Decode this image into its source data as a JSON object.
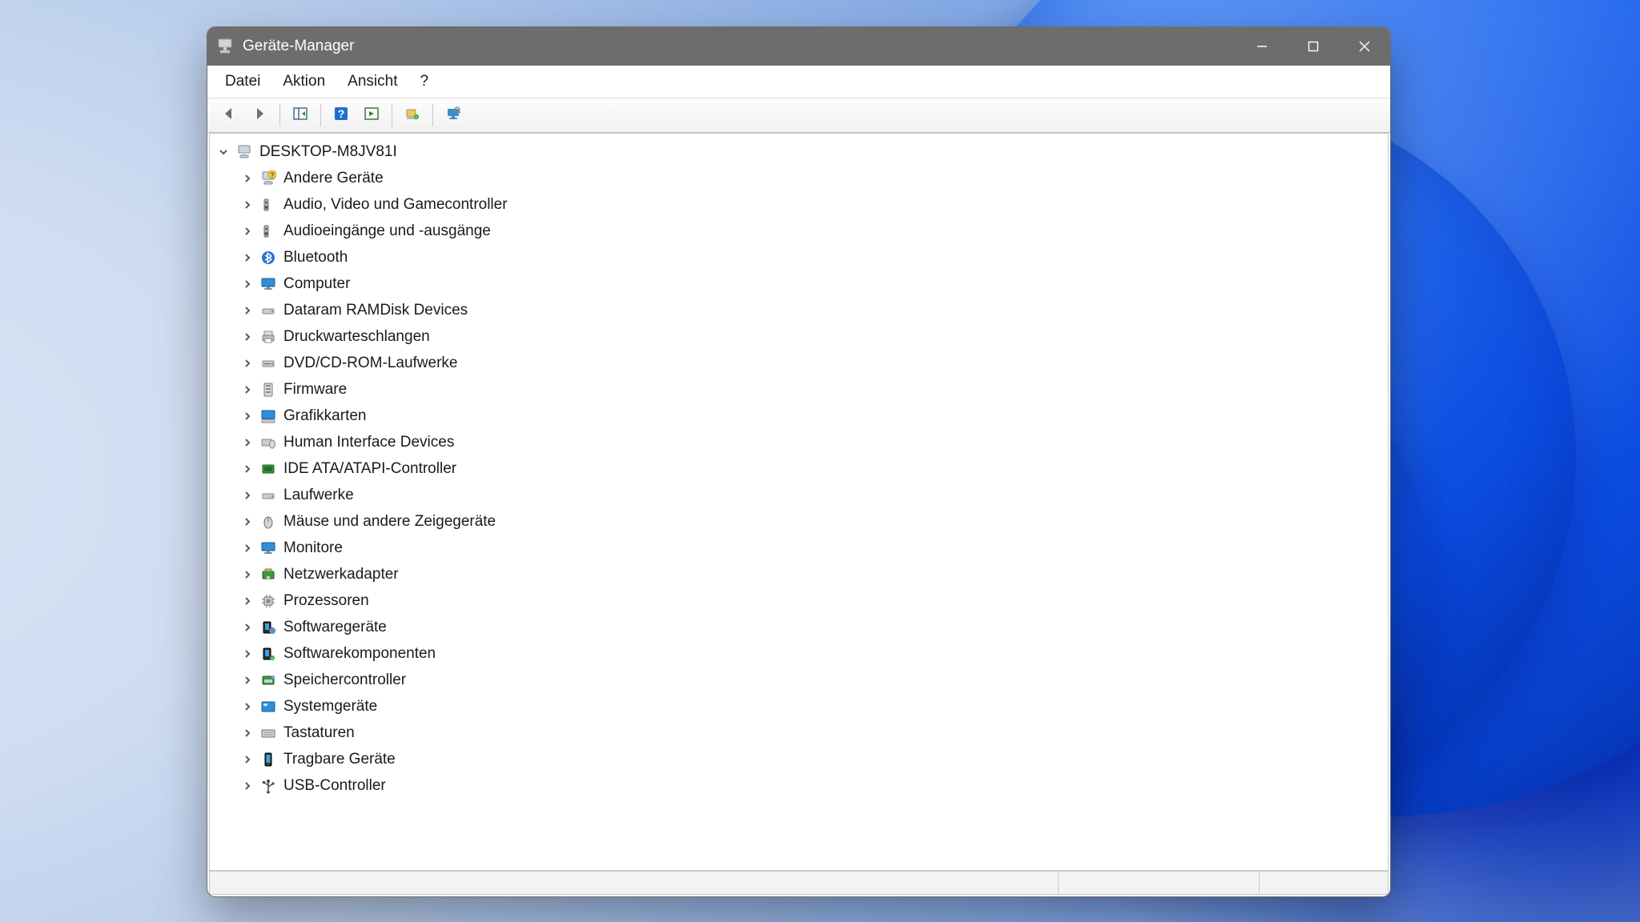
{
  "window": {
    "title": "Geräte-Manager"
  },
  "menubar": {
    "items": [
      "Datei",
      "Aktion",
      "Ansicht",
      "?"
    ]
  },
  "toolbar": {
    "buttons": [
      {
        "name": "nav-back-icon"
      },
      {
        "name": "nav-forward-icon"
      },
      {
        "sep": true
      },
      {
        "name": "show-hide-tree-icon"
      },
      {
        "sep": true
      },
      {
        "name": "help-icon"
      },
      {
        "name": "properties-icon"
      },
      {
        "sep": true
      },
      {
        "name": "update-driver-icon"
      },
      {
        "sep": true
      },
      {
        "name": "scan-hardware-icon"
      }
    ]
  },
  "tree": {
    "root": {
      "label": "DESKTOP-M8JV81I",
      "icon": "computer-root-icon",
      "expanded": true
    },
    "children": [
      {
        "label": "Andere Geräte",
        "icon": "unknown-device-icon"
      },
      {
        "label": "Audio, Video und Gamecontroller",
        "icon": "audio-icon"
      },
      {
        "label": "Audioeingänge und -ausgänge",
        "icon": "audio-icon"
      },
      {
        "label": "Bluetooth",
        "icon": "bluetooth-icon"
      },
      {
        "label": "Computer",
        "icon": "monitor-icon"
      },
      {
        "label": "Dataram RAMDisk Devices",
        "icon": "disk-icon"
      },
      {
        "label": "Druckwarteschlangen",
        "icon": "printer-icon"
      },
      {
        "label": "DVD/CD-ROM-Laufwerke",
        "icon": "optical-drive-icon"
      },
      {
        "label": "Firmware",
        "icon": "firmware-icon"
      },
      {
        "label": "Grafikkarten",
        "icon": "display-adapter-icon"
      },
      {
        "label": "Human Interface Devices",
        "icon": "hid-icon"
      },
      {
        "label": "IDE ATA/ATAPI-Controller",
        "icon": "ide-controller-icon"
      },
      {
        "label": "Laufwerke",
        "icon": "disk-icon"
      },
      {
        "label": "Mäuse und andere Zeigegeräte",
        "icon": "mouse-icon"
      },
      {
        "label": "Monitore",
        "icon": "monitor-icon"
      },
      {
        "label": "Netzwerkadapter",
        "icon": "network-icon"
      },
      {
        "label": "Prozessoren",
        "icon": "cpu-icon"
      },
      {
        "label": "Softwaregeräte",
        "icon": "software-device-icon"
      },
      {
        "label": "Softwarekomponenten",
        "icon": "software-component-icon"
      },
      {
        "label": "Speichercontroller",
        "icon": "storage-controller-icon"
      },
      {
        "label": "Systemgeräte",
        "icon": "system-device-icon"
      },
      {
        "label": "Tastaturen",
        "icon": "keyboard-icon"
      },
      {
        "label": "Tragbare Geräte",
        "icon": "portable-device-icon"
      },
      {
        "label": "USB-Controller",
        "icon": "usb-icon"
      }
    ]
  }
}
